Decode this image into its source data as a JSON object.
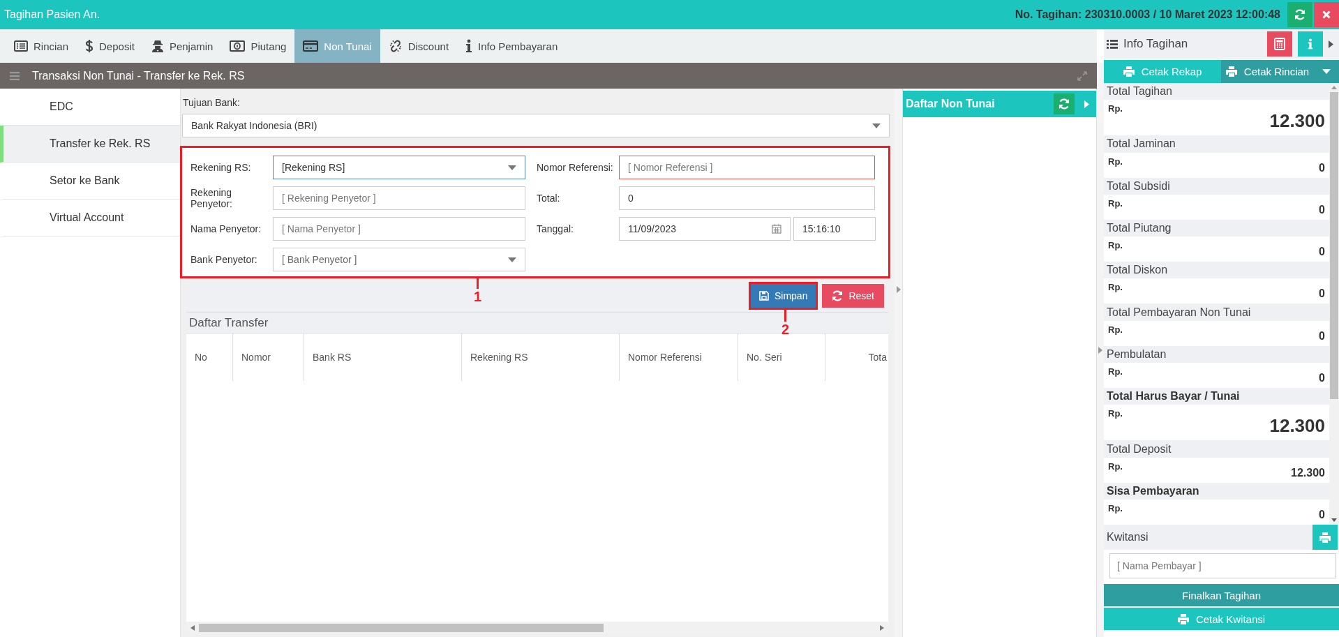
{
  "title_bar": {
    "title": "Tagihan Pasien An.",
    "bill_info": "No. Tagihan: 230310.0003 / 10 Maret 2023 12:00:48"
  },
  "tabs": [
    {
      "label": "Rincian",
      "selected": false
    },
    {
      "label": "Deposit",
      "selected": false
    },
    {
      "label": "Penjamin",
      "selected": false
    },
    {
      "label": "Piutang",
      "selected": false
    },
    {
      "label": "Non Tunai",
      "selected": true
    },
    {
      "label": "Discount",
      "selected": false
    },
    {
      "label": "Info Pembayaran",
      "selected": false
    }
  ],
  "panel_header": {
    "title": "Transaksi Non Tunai - Transfer ke Rek. RS"
  },
  "sidebar": {
    "items": [
      {
        "label": "EDC",
        "selected": false
      },
      {
        "label": "Transfer ke Rek. RS",
        "selected": true
      },
      {
        "label": "Setor ke Bank",
        "selected": false
      },
      {
        "label": "Virtual Account",
        "selected": false
      }
    ]
  },
  "form": {
    "bank_label": "Tujuan Bank:",
    "bank_value": "Bank Rakyat Indonesia (BRI)",
    "left_fields": [
      {
        "label": "Rekening RS:",
        "kind": "select",
        "text": "[Rekening RS]",
        "focused": true,
        "invalid": false
      },
      {
        "label": "Rekening Penyetor:",
        "kind": "input",
        "placeholder": "[ Rekening Penyetor ]",
        "focused": false,
        "invalid": false
      },
      {
        "label": "Nama Penyetor:",
        "kind": "input",
        "placeholder": "[ Nama Penyetor ]",
        "focused": false,
        "invalid": false
      },
      {
        "label": "Bank Penyetor:",
        "kind": "select",
        "text": "[ Bank Penyetor ]",
        "focused": false,
        "invalid": false
      }
    ],
    "right_fields": [
      {
        "label": "Nomor Referensi:",
        "kind": "input",
        "placeholder": "[ Nomor Referensi ]",
        "focused": false,
        "invalid": true
      },
      {
        "label": "Total:",
        "kind": "input",
        "value": "0",
        "focused": false,
        "invalid": false
      },
      {
        "label": "Tanggal:",
        "kind": "datetime",
        "date": "11/09/2023",
        "time": "15:16:10",
        "focused": false,
        "invalid": false
      }
    ]
  },
  "buttons": [
    {
      "label": "Simpan",
      "kind": "save"
    },
    {
      "label": "Reset",
      "kind": "reset"
    }
  ],
  "annotations": [
    {
      "label": "1"
    },
    {
      "label": "2"
    }
  ],
  "transfer_table": {
    "title": "Daftar Transfer",
    "columns": [
      "No",
      "Nomor",
      "Bank RS",
      "Rekening RS",
      "Nomor Referensi",
      "No. Seri",
      "Tota"
    ]
  },
  "non_tunai_panel": {
    "title": "Daftar Non Tunai"
  },
  "info_panel": {
    "title": "Info Tagihan",
    "print_buttons": [
      "Cetak Rekap",
      "Cetak Rincian"
    ],
    "totals": [
      {
        "label": "Total Tagihan",
        "currency": "Rp.",
        "amount": "12.300",
        "large": true,
        "label_bold": false
      },
      {
        "label": "Total Jaminan",
        "currency": "Rp.",
        "amount": "0",
        "large": false,
        "label_bold": false
      },
      {
        "label": "Total Subsidi",
        "currency": "Rp.",
        "amount": "0",
        "large": false,
        "label_bold": false
      },
      {
        "label": "Total Piutang",
        "currency": "Rp.",
        "amount": "0",
        "large": false,
        "label_bold": false
      },
      {
        "label": "Total Diskon",
        "currency": "Rp.",
        "amount": "0",
        "large": false,
        "label_bold": false
      },
      {
        "label": "Total Pembayaran Non Tunai",
        "currency": "Rp.",
        "amount": "0",
        "large": false,
        "label_bold": false
      },
      {
        "label": "Pembulatan",
        "currency": "Rp.",
        "amount": "0",
        "large": false,
        "label_bold": false
      },
      {
        "label": "Total Harus Bayar / Tunai",
        "currency": "Rp.",
        "amount": "12.300",
        "large": true,
        "label_bold": true
      },
      {
        "label": "Total Deposit",
        "currency": "Rp.",
        "amount": "12.300",
        "large": false,
        "label_bold": false
      },
      {
        "label": "Sisa Pembayaran",
        "currency": "Rp.",
        "amount": "0",
        "large": false,
        "label_bold": true
      }
    ],
    "kwitansi_label": "Kwitansi",
    "payer_placeholder": "[ Nama Pembayar ]",
    "finalize_button": "Finalkan Tagihan",
    "receipt_button": "Cetak Kwitansi"
  }
}
